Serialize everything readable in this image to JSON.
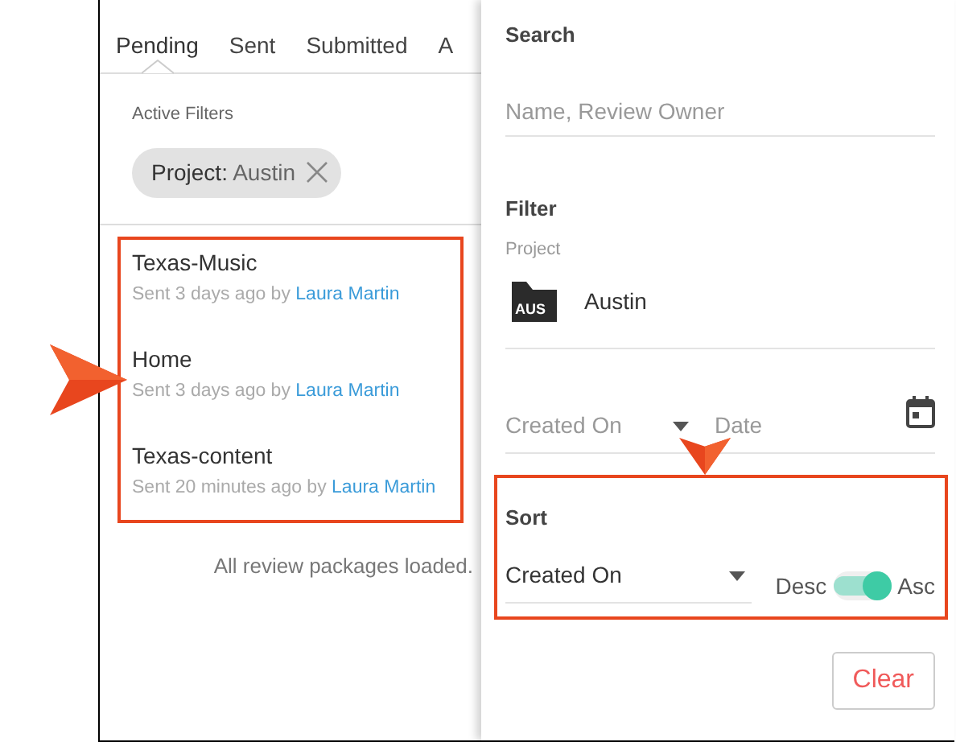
{
  "tabs": [
    {
      "label": "Pending",
      "selected": true
    },
    {
      "label": "Sent",
      "selected": false
    },
    {
      "label": "Submitted",
      "selected": false
    },
    {
      "label": "A",
      "selected": false
    }
  ],
  "active_filters": {
    "label": "Active Filters",
    "chips": [
      {
        "key": "Project:",
        "value": "Austin"
      }
    ]
  },
  "packages": [
    {
      "title": "Texas-Music",
      "sent": "Sent 3 days ago by",
      "owner": "Laura Martin"
    },
    {
      "title": "Home",
      "sent": "Sent 3 days ago by",
      "owner": "Laura Martin"
    },
    {
      "title": "Texas-content",
      "sent": "Sent 20 minutes ago by",
      "owner": "Laura Martin"
    }
  ],
  "footer": "All review packages loaded.",
  "panel": {
    "search": {
      "heading": "Search",
      "placeholder": "Name, Review Owner"
    },
    "filter": {
      "heading": "Filter",
      "project_label": "Project",
      "project_badge": "AUS",
      "project_name": "Austin",
      "date_type": "Created On",
      "date_placeholder": "Date"
    },
    "sort": {
      "heading": "Sort",
      "field": "Created On",
      "desc_label": "Desc",
      "asc_label": "Asc",
      "ascending": true
    },
    "clear_button": "Clear"
  }
}
